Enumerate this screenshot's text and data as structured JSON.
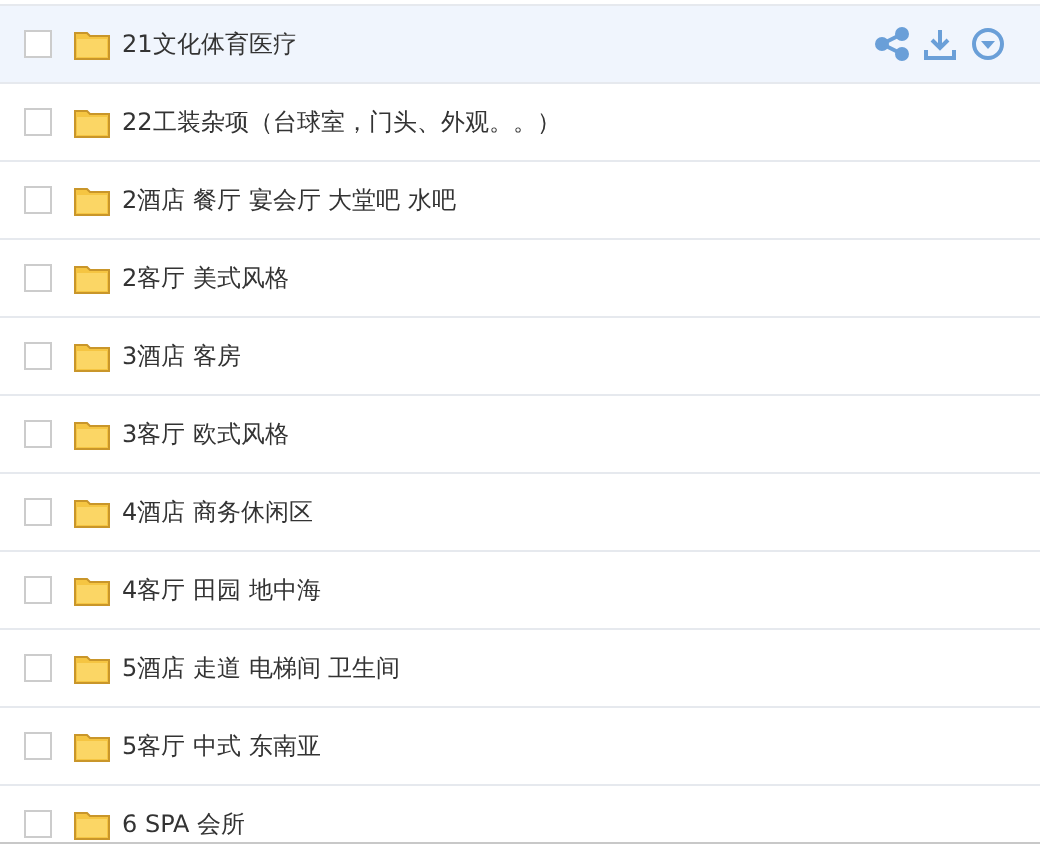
{
  "files": [
    {
      "name": "21文化体育医疗",
      "checked": false,
      "highlighted": true
    },
    {
      "name": "22工装杂项（台球室，门头、外观。。）",
      "checked": false,
      "highlighted": false
    },
    {
      "name": "2酒店 餐厅 宴会厅 大堂吧 水吧",
      "checked": false,
      "highlighted": false
    },
    {
      "name": "2客厅 美式风格",
      "checked": false,
      "highlighted": false
    },
    {
      "name": "3酒店 客房",
      "checked": false,
      "highlighted": false
    },
    {
      "name": "3客厅 欧式风格",
      "checked": false,
      "highlighted": false
    },
    {
      "name": "4酒店 商务休闲区",
      "checked": false,
      "highlighted": false
    },
    {
      "name": "4客厅 田园 地中海",
      "checked": false,
      "highlighted": false
    },
    {
      "name": "5酒店 走道 电梯间 卫生间",
      "checked": false,
      "highlighted": false
    },
    {
      "name": "5客厅 中式 东南亚",
      "checked": false,
      "highlighted": false
    },
    {
      "name": "6 SPA 会所",
      "checked": false,
      "highlighted": false
    }
  ]
}
